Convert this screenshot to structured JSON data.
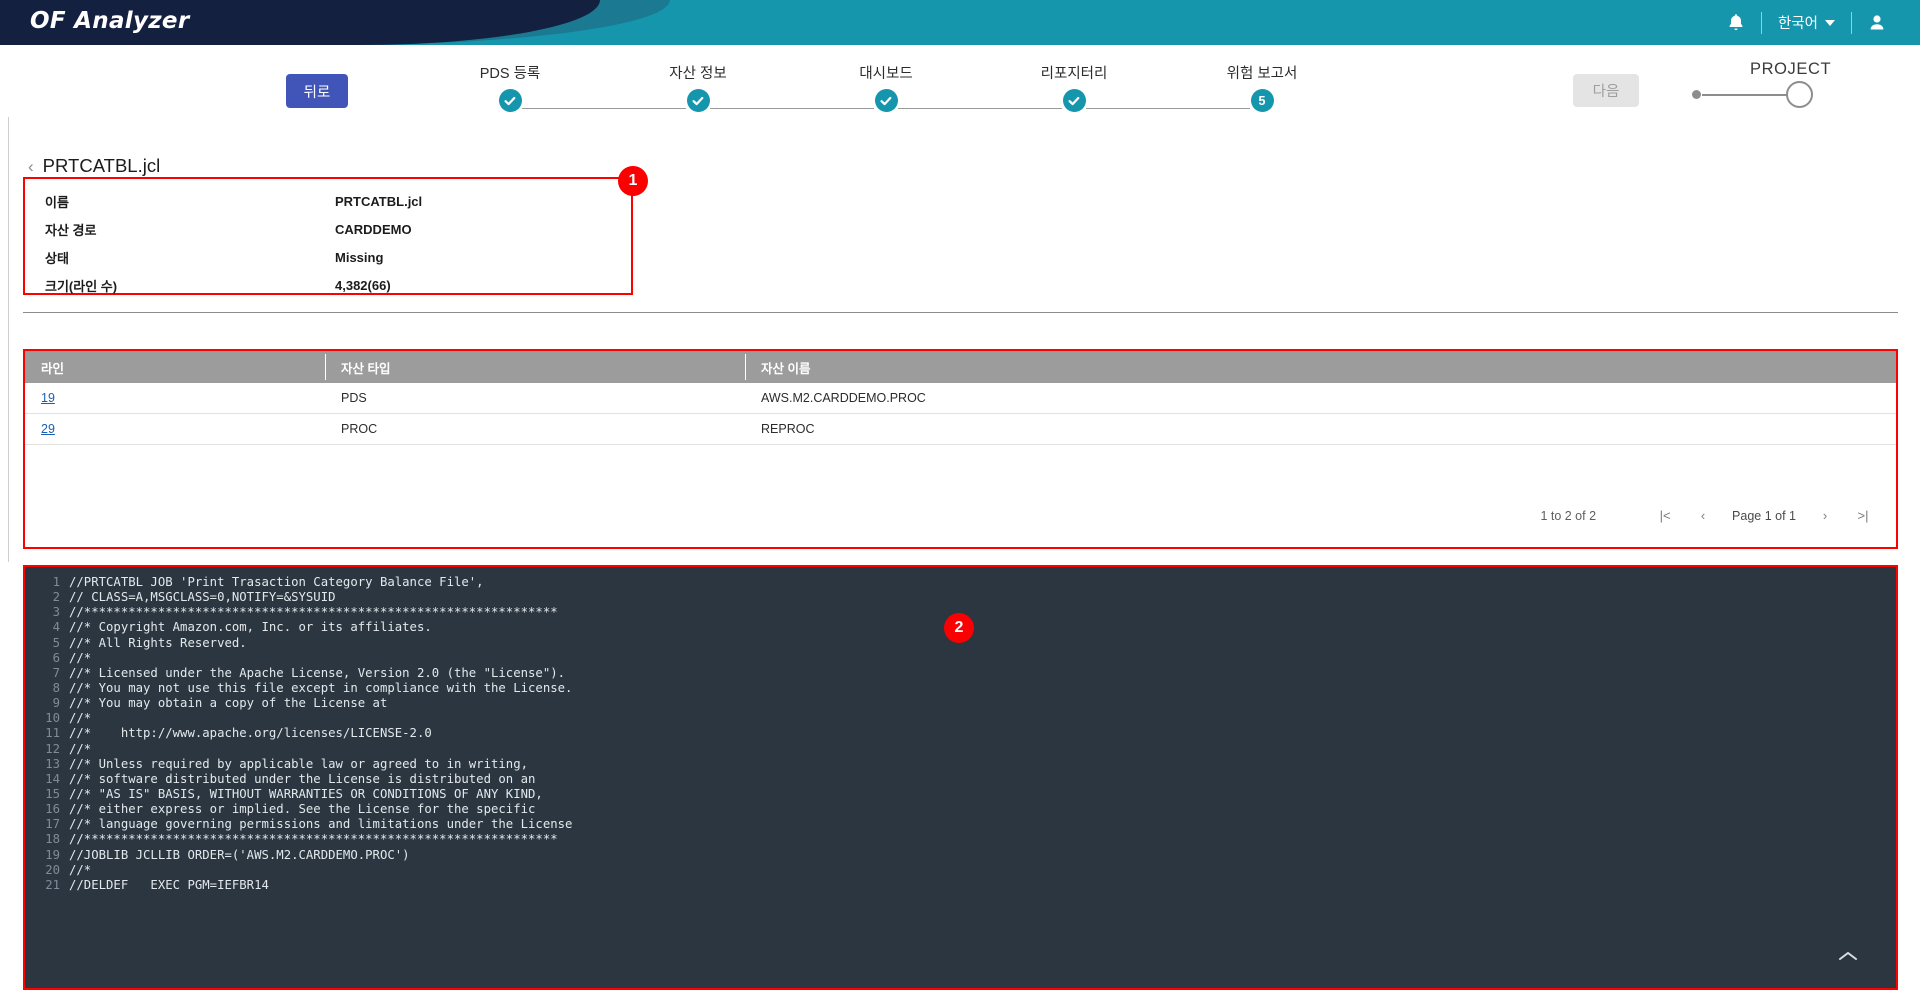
{
  "header": {
    "brand": "OF Analyzer",
    "notification_icon": "bell-icon",
    "language": "한국어",
    "profile_icon": "user-icon"
  },
  "stepper": {
    "back_label": "뒤로",
    "next_label": "다음",
    "steps": [
      {
        "label": "PDS 등록",
        "state": "done",
        "mark": "check"
      },
      {
        "label": "자산 정보",
        "state": "done",
        "mark": "check"
      },
      {
        "label": "대시보드",
        "state": "done",
        "mark": "check"
      },
      {
        "label": "리포지터리",
        "state": "done",
        "mark": "check"
      },
      {
        "label": "위험 보고서",
        "state": "current",
        "mark": "5"
      }
    ],
    "project_label": "PROJECT"
  },
  "breadcrumb": {
    "back_arrow": "‹",
    "title": "PRTCATBL.jcl"
  },
  "info_panel": {
    "rows": [
      {
        "key": "이름",
        "value": "PRTCATBL.jcl"
      },
      {
        "key": "자산 경로",
        "value": "CARDDEMO"
      },
      {
        "key": "상태",
        "value": "Missing"
      },
      {
        "key": "크기(라인 수)",
        "value": "4,382(66)"
      }
    ]
  },
  "table": {
    "columns": [
      "라인",
      "자산 타입",
      "자산 이름"
    ],
    "rows": [
      {
        "line": "19",
        "type": "PDS",
        "name": "AWS.M2.CARDDEMO.PROC"
      },
      {
        "line": "29",
        "type": "PROC",
        "name": "REPROC"
      }
    ],
    "pager": {
      "count_text": "1 to 2 of 2",
      "first_icon": "|<",
      "prev_icon": "‹",
      "page_text": "Page 1 of 1",
      "next_icon": "›",
      "last_icon": ">|"
    }
  },
  "code": {
    "collapse_icon": "chevron-up-icon",
    "lines": [
      {
        "n": "1",
        "t": "//PRTCATBL JOB 'Print Trasaction Category Balance File',"
      },
      {
        "n": "2",
        "t": "// CLASS=A,MSGCLASS=0,NOTIFY=&SYSUID"
      },
      {
        "n": "3",
        "t": "//****************************************************************"
      },
      {
        "n": "4",
        "t": "//* Copyright Amazon.com, Inc. or its affiliates."
      },
      {
        "n": "5",
        "t": "//* All Rights Reserved."
      },
      {
        "n": "6",
        "t": "//*"
      },
      {
        "n": "7",
        "t": "//* Licensed under the Apache License, Version 2.0 (the \"License\")."
      },
      {
        "n": "8",
        "t": "//* You may not use this file except in compliance with the License."
      },
      {
        "n": "9",
        "t": "//* You may obtain a copy of the License at"
      },
      {
        "n": "10",
        "t": "//*"
      },
      {
        "n": "11",
        "t": "//*    http://www.apache.org/licenses/LICENSE-2.0"
      },
      {
        "n": "12",
        "t": "//*"
      },
      {
        "n": "13",
        "t": "//* Unless required by applicable law or agreed to in writing,"
      },
      {
        "n": "14",
        "t": "//* software distributed under the License is distributed on an"
      },
      {
        "n": "15",
        "t": "//* \"AS IS\" BASIS, WITHOUT WARRANTIES OR CONDITIONS OF ANY KIND,"
      },
      {
        "n": "16",
        "t": "//* either express or implied. See the License for the specific"
      },
      {
        "n": "17",
        "t": "//* language governing permissions and limitations under the License"
      },
      {
        "n": "18",
        "t": "//****************************************************************"
      },
      {
        "n": "19",
        "t": "//JOBLIB JCLLIB ORDER=('AWS.M2.CARDDEMO.PROC')"
      },
      {
        "n": "20",
        "t": "//*"
      },
      {
        "n": "21",
        "t": "//DELDEF   EXEC PGM=IEFBR14"
      }
    ]
  },
  "annotations": [
    {
      "id": "1",
      "label": "1"
    },
    {
      "id": "2",
      "label": "2"
    }
  ],
  "colors": {
    "header_teal": "#1596ad",
    "header_navy": "#14203f",
    "back_blue": "#4154b7",
    "annotation_red": "#ff0000",
    "table_header_gray": "#9c9c9c",
    "code_bg": "#2b3640"
  }
}
